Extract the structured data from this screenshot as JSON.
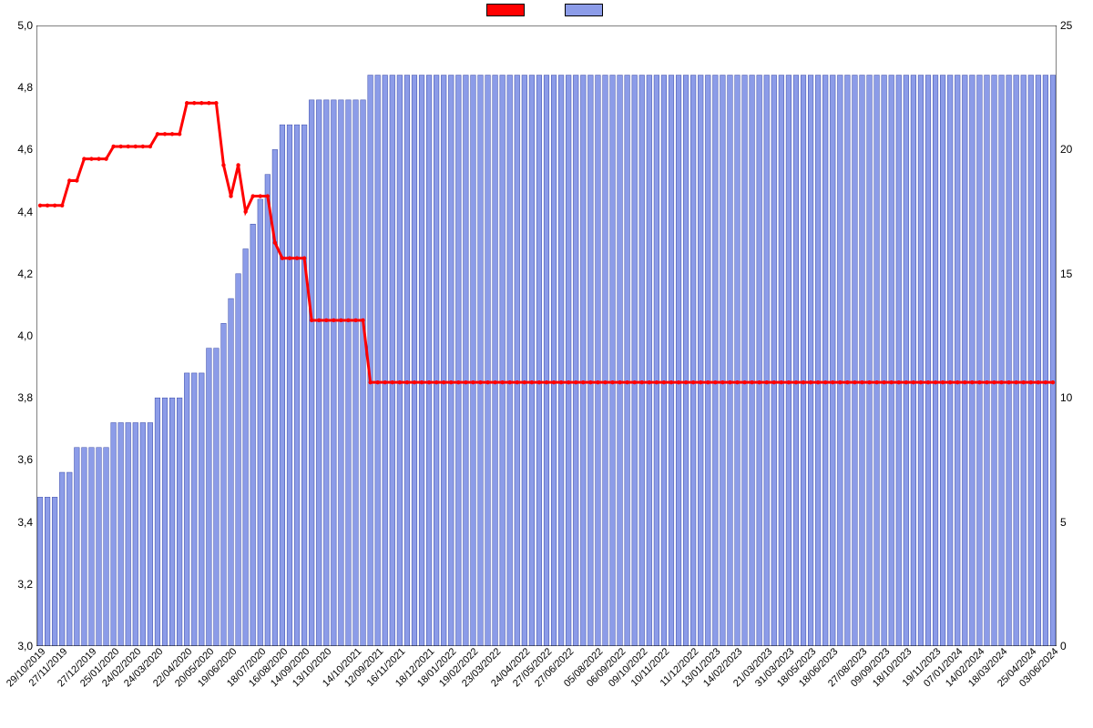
{
  "chart_data": {
    "type": "bar+line",
    "title": "",
    "xlabel": "",
    "left_axis": {
      "min": 3.0,
      "max": 5.0,
      "ticks": [
        3.0,
        3.2,
        3.4,
        3.6,
        3.8,
        4.0,
        4.2,
        4.4,
        4.6,
        4.8,
        5.0
      ],
      "tick_labels": [
        "3,0",
        "3,2",
        "3,4",
        "3,6",
        "3,8",
        "4,0",
        "4,2",
        "4,4",
        "4,6",
        "4,8",
        "5,0"
      ]
    },
    "right_axis": {
      "min": 0,
      "max": 25,
      "ticks": [
        0,
        5,
        10,
        15,
        20,
        25
      ],
      "tick_labels": [
        "0",
        "5",
        "10",
        "15",
        "20",
        "25"
      ]
    },
    "categories": [
      "29/10/2019",
      "27/11/2019",
      "27/12/2019",
      "25/01/2020",
      "24/02/2020",
      "24/03/2020",
      "22/04/2020",
      "20/05/2020",
      "19/06/2020",
      "18/07/2020",
      "16/08/2020",
      "14/09/2020",
      "13/10/2020",
      "14/10/2021",
      "12/09/2021",
      "16/11/2021",
      "18/12/2021",
      "18/01/2022",
      "19/02/2022",
      "23/03/2022",
      "24/04/2022",
      "27/05/2022",
      "27/06/2022",
      "05/08/2022",
      "06/09/2022",
      "09/10/2022",
      "10/11/2022",
      "11/12/2022",
      "13/01/2023",
      "14/02/2023",
      "21/03/2023",
      "31/03/2023",
      "18/05/2023",
      "18/06/2023",
      "27/08/2023",
      "09/09/2023",
      "18/10/2023",
      "19/11/2023",
      "07/01/2024",
      "14/02/2024",
      "18/03/2024",
      "25/04/2024",
      "03/06/2024"
    ],
    "series": [
      {
        "name": "",
        "type": "line",
        "axis": "left",
        "color": "#ff0000",
        "values": [
          4.42,
          4.42,
          4.42,
          4.42,
          4.5,
          4.5,
          4.57,
          4.57,
          4.57,
          4.57,
          4.61,
          4.61,
          4.61,
          4.61,
          4.61,
          4.61,
          4.65,
          4.65,
          4.65,
          4.65,
          4.75,
          4.75,
          4.75,
          4.75,
          4.75,
          4.55,
          4.45,
          4.55,
          4.4,
          4.45,
          4.45,
          4.45,
          4.3,
          4.25,
          4.25,
          4.25,
          4.25,
          4.05,
          4.05,
          4.05,
          4.05,
          4.05,
          4.05,
          4.05,
          4.05,
          3.85,
          3.85,
          3.85,
          3.85,
          3.85,
          3.85,
          3.85,
          3.85,
          3.85,
          3.85,
          3.85,
          3.85,
          3.85,
          3.85,
          3.85,
          3.85,
          3.85,
          3.85,
          3.85,
          3.85,
          3.85,
          3.85,
          3.85,
          3.85,
          3.85,
          3.85,
          3.85,
          3.85,
          3.85,
          3.85,
          3.85,
          3.85,
          3.85,
          3.85,
          3.85,
          3.85,
          3.85,
          3.85,
          3.85,
          3.85,
          3.85,
          3.85,
          3.85,
          3.85,
          3.85,
          3.85,
          3.85,
          3.85,
          3.85,
          3.85,
          3.85,
          3.85,
          3.85,
          3.85,
          3.85,
          3.85,
          3.85,
          3.85,
          3.85,
          3.85,
          3.85,
          3.85,
          3.85,
          3.85,
          3.85,
          3.85,
          3.85,
          3.85,
          3.85,
          3.85,
          3.85,
          3.85,
          3.85,
          3.85,
          3.85,
          3.85,
          3.85,
          3.85,
          3.85,
          3.85,
          3.85,
          3.85,
          3.85,
          3.85,
          3.85,
          3.85,
          3.85,
          3.85,
          3.85,
          3.85,
          3.85,
          3.85,
          3.85,
          3.85
        ]
      },
      {
        "name": "",
        "type": "bar",
        "axis": "right",
        "color": "#8c9ce8",
        "values": [
          6,
          6,
          6,
          7,
          7,
          8,
          8,
          8,
          8,
          8,
          9,
          9,
          9,
          9,
          9,
          9,
          10,
          10,
          10,
          10,
          11,
          11,
          11,
          12,
          12,
          13,
          14,
          15,
          16,
          17,
          18,
          19,
          20,
          21,
          21,
          21,
          21,
          22,
          22,
          22,
          22,
          22,
          22,
          22,
          22,
          23,
          23,
          23,
          23,
          23,
          23,
          23,
          23,
          23,
          23,
          23,
          23,
          23,
          23,
          23,
          23,
          23,
          23,
          23,
          23,
          23,
          23,
          23,
          23,
          23,
          23,
          23,
          23,
          23,
          23,
          23,
          23,
          23,
          23,
          23,
          23,
          23,
          23,
          23,
          23,
          23,
          23,
          23,
          23,
          23,
          23,
          23,
          23,
          23,
          23,
          23,
          23,
          23,
          23,
          23,
          23,
          23,
          23,
          23,
          23,
          23,
          23,
          23,
          23,
          23,
          23,
          23,
          23,
          23,
          23,
          23,
          23,
          23,
          23,
          23,
          23,
          23,
          23,
          23,
          23,
          23,
          23,
          23,
          23,
          23,
          23,
          23,
          23,
          23,
          23,
          23,
          23,
          23,
          23
        ]
      }
    ],
    "legend": {
      "position": "top",
      "items": [
        {
          "color": "#ff0000",
          "label": ""
        },
        {
          "color": "#8c9ce8",
          "label": ""
        }
      ]
    }
  }
}
